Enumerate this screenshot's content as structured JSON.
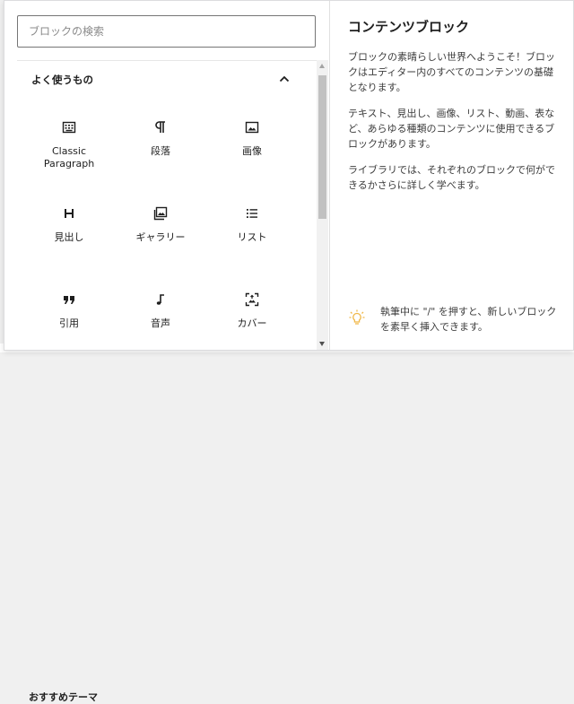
{
  "search": {
    "placeholder": "ブロックの検索"
  },
  "panel": {
    "title": "よく使うもの"
  },
  "blocks": [
    {
      "label": "Classic\nParagraph",
      "icon": "classic-icon"
    },
    {
      "label": "段落",
      "icon": "paragraph-icon"
    },
    {
      "label": "画像",
      "icon": "image-icon"
    },
    {
      "label": "見出し",
      "icon": "heading-icon"
    },
    {
      "label": "ギャラリー",
      "icon": "gallery-icon"
    },
    {
      "label": "リスト",
      "icon": "list-icon"
    },
    {
      "label": "引用",
      "icon": "quote-icon"
    },
    {
      "label": "音声",
      "icon": "audio-icon"
    },
    {
      "label": "カバー",
      "icon": "cover-icon"
    }
  ],
  "preview": {
    "title": "コンテンツブロック",
    "paragraphs": [
      "ブロックの素晴らしい世界へようこそ！ブロックはエディター内のすべてのコンテンツの基礎となります。",
      "テキスト、見出し、画像、リスト、動画、表など、あらゆる種類のコンテンツに使用できるブロックがあります。",
      "ライブラリでは、それぞれのブロックで何ができるかさらに詳しく学べます。"
    ],
    "tip": "執筆中に \"/\" を押すと、新しいブロックを素早く挿入できます。"
  },
  "background": {
    "partial_text": "おすすめテーマ"
  },
  "colors": {
    "border": "#757575",
    "text": "#1e1e1e",
    "tip_icon": "#f0b849"
  }
}
